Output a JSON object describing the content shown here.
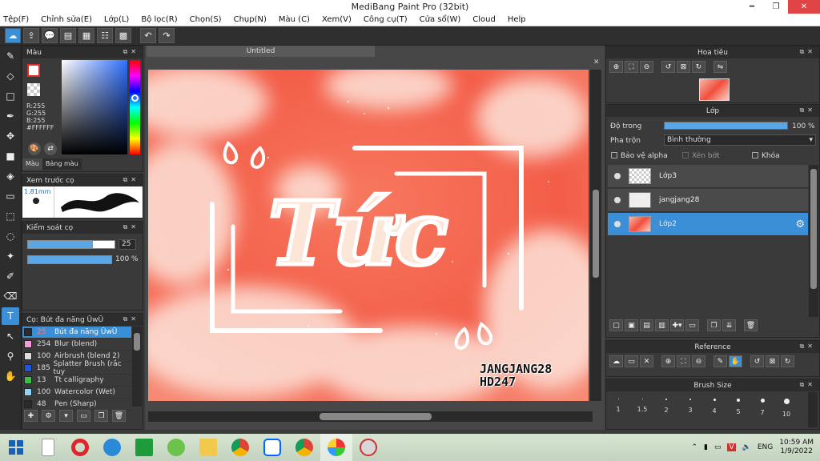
{
  "window": {
    "title": "MediBang Paint Pro (32bit)"
  },
  "menu": [
    "Tệp(F)",
    "Chỉnh sửa(E)",
    "Lớp(L)",
    "Bộ lọc(R)",
    "Chọn(S)",
    "Chụp(N)",
    "Màu (C)",
    "Xem(V)",
    "Công cụ(T)",
    "Cửa sổ(W)",
    "Cloud",
    "Help"
  ],
  "color_panel": {
    "title": "Màu",
    "r": "R:255",
    "g": "G:255",
    "b": "B:255",
    "hex": "#FFFFFF",
    "tab_color": "Màu",
    "tab_palette": "Bảng màu",
    "front_color": "#ffffff",
    "outline_color": "#e02a2a"
  },
  "brush_preview": {
    "title": "Xem trước cọ",
    "size": "1.81mm"
  },
  "brush_control": {
    "title": "Kiểm soát cọ",
    "size_value": "25",
    "size_fraction": 0.75,
    "opacity_value": "100 %",
    "opacity_fraction": 1.0
  },
  "brush_list": {
    "title": "Cọ: Bút đa năng ŪwŪ",
    "items": [
      {
        "num": "25",
        "name": "Bút đa năng ŪwŪ",
        "color": "#2a2a2a",
        "selected": true
      },
      {
        "num": "254",
        "name": "Blur (blend)",
        "color": "#f59cd8"
      },
      {
        "num": "100",
        "name": "Airbrush (blend 2)",
        "color": "#dddddd"
      },
      {
        "num": "185",
        "name": "Splatter Brush (rắc tuy",
        "color": "#2255dd"
      },
      {
        "num": "13",
        "name": "Tt calligraphy",
        "color": "#3bbf4a"
      },
      {
        "num": "100",
        "name": "Watercolor (Wet)",
        "color": "#8fd4f0"
      },
      {
        "num": "48",
        "name": "Pen (Sharp)",
        "color": "#2a2a2a"
      }
    ]
  },
  "canvas": {
    "tab": "Untitled",
    "artwork_text": "Tức",
    "signature_line1": "JANGJANG28",
    "signature_line2": "HD247"
  },
  "navigator": {
    "title": "Hoa tiêu"
  },
  "layers": {
    "title": "Lớp",
    "opacity_label": "Độ trong",
    "opacity_value": "100 %",
    "opacity_fraction": 1.0,
    "blend_label": "Pha trộn",
    "blend_value": "Bình thường",
    "protect_alpha": "Bảo vệ alpha",
    "clipping": "Xén bớt",
    "lock": "Khóa",
    "items": [
      {
        "name": "Lớp3",
        "selected": false
      },
      {
        "name": "jangjang28",
        "selected": false
      },
      {
        "name": "Lớp2",
        "selected": true
      }
    ]
  },
  "reference": {
    "title": "Reference"
  },
  "brush_size": {
    "title": "Brush Size",
    "sizes": [
      "1",
      "1.5",
      "2",
      "3",
      "4",
      "5",
      "7",
      "10"
    ]
  },
  "taskbar": {
    "lang": "ENG",
    "time": "10:59 AM",
    "date": "1/9/2022"
  }
}
